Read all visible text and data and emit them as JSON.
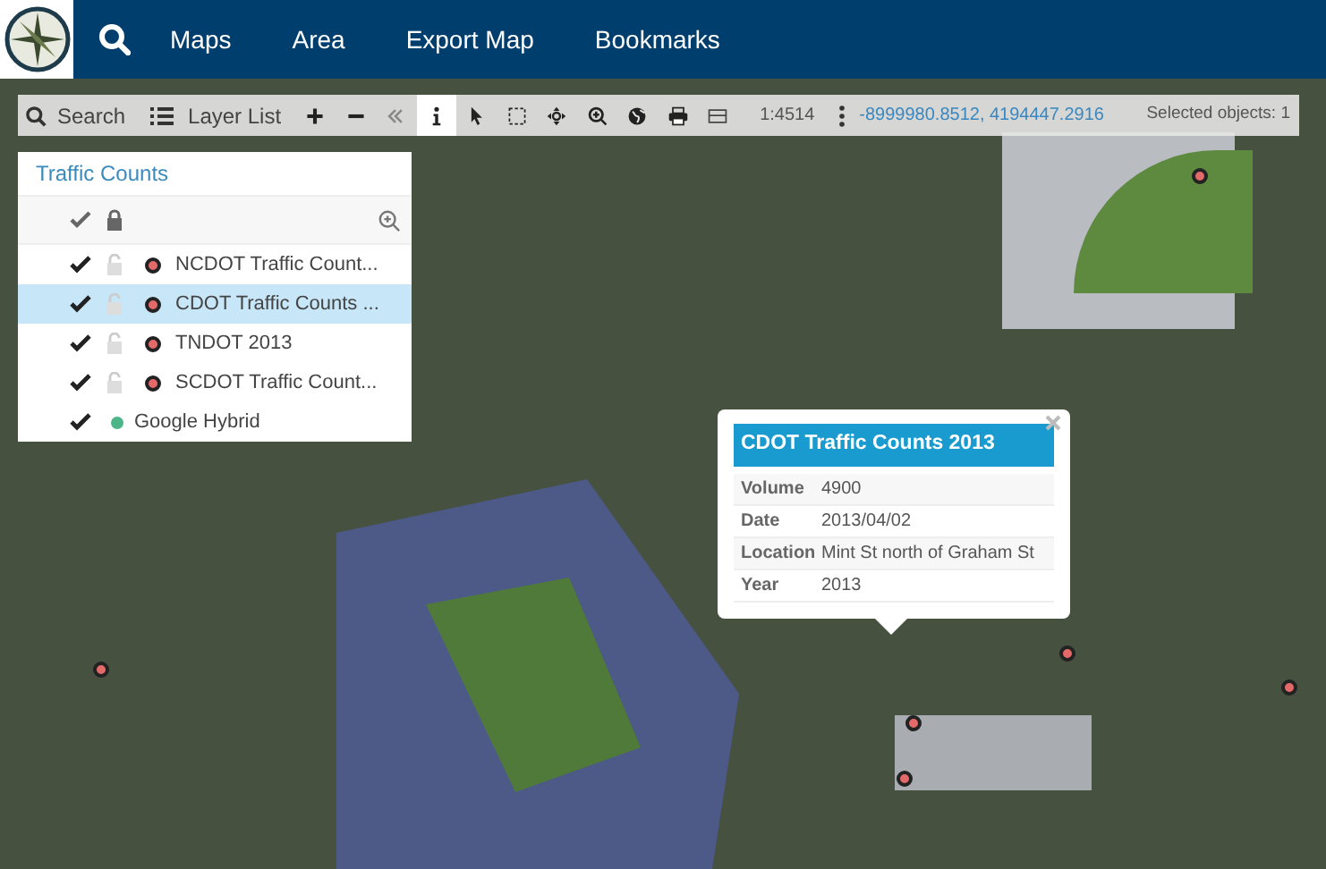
{
  "nav": {
    "menu": [
      {
        "label": "Maps"
      },
      {
        "label": "Area"
      },
      {
        "label": "Export Map"
      },
      {
        "label": "Bookmarks"
      }
    ]
  },
  "toolbar": {
    "search_label": "Search",
    "layer_list_label": "Layer List",
    "tools": [
      {
        "selected": false
      },
      {
        "selected": false
      },
      {
        "selected": false
      },
      {
        "selected": true
      },
      {
        "selected": false
      },
      {
        "selected": false
      },
      {
        "selected": false
      },
      {
        "selected": false
      },
      {
        "selected": false
      },
      {
        "selected": false
      },
      {
        "selected": false
      }
    ],
    "scale": "1:4514",
    "coordinates": "-8999980.8512, 4194447.2916",
    "selected_objects": "Selected objects: 1"
  },
  "layer_panel": {
    "title": "Traffic Counts",
    "layers": [
      {
        "label": "NCDOT Traffic Count...",
        "kind": "point",
        "checked": true,
        "locked": false,
        "selected": false
      },
      {
        "label": "CDOT Traffic Counts ...",
        "kind": "point",
        "checked": true,
        "locked": false,
        "selected": true
      },
      {
        "label": "TNDOT 2013",
        "kind": "point",
        "checked": true,
        "locked": false,
        "selected": false
      },
      {
        "label": "SCDOT Traffic Count...",
        "kind": "point",
        "checked": true,
        "locked": false,
        "selected": false
      },
      {
        "label": "Google Hybrid",
        "kind": "basemap",
        "checked": true,
        "selected": false
      }
    ]
  },
  "popup": {
    "title": "CDOT Traffic Counts 2013",
    "rows": [
      {
        "field": "Volume",
        "value": "4900"
      },
      {
        "field": "Date",
        "value": "2013/04/02"
      },
      {
        "field": "Location",
        "value": "Mint St north of Graham St"
      },
      {
        "field": "Year",
        "value": "2013"
      }
    ]
  }
}
